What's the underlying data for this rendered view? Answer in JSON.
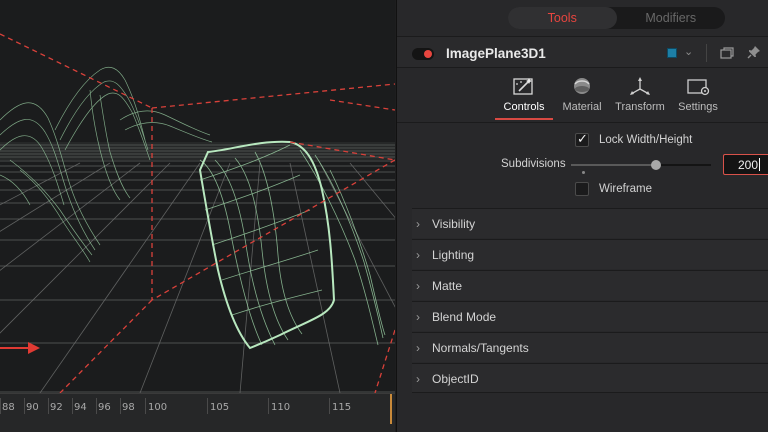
{
  "inspector": {
    "top_tabs": [
      {
        "label": "Tools",
        "active": true
      },
      {
        "label": "Modifiers",
        "active": false
      }
    ],
    "tool_name": "ImagePlane3D1",
    "tool_color": "#1d7fa6",
    "sub_tabs": [
      {
        "label": "Controls",
        "icon": "controls-icon",
        "active": true
      },
      {
        "label": "Material",
        "icon": "material-icon",
        "active": false
      },
      {
        "label": "Transform",
        "icon": "transform-icon",
        "active": false
      },
      {
        "label": "Settings",
        "icon": "settings-icon",
        "active": false
      }
    ],
    "lock_width_height": {
      "label": "Lock Width/Height",
      "checked": true
    },
    "subdivisions": {
      "label": "Subdivisions",
      "value": "200",
      "slider_fraction": 0.61
    },
    "wireframe": {
      "label": "Wireframe",
      "checked": false
    },
    "sections": [
      "Visibility",
      "Lighting",
      "Matte",
      "Blend Mode",
      "Normals/Tangents",
      "ObjectID"
    ]
  },
  "timeline": {
    "ticks": [
      "88",
      "90",
      "92",
      "94",
      "96",
      "98",
      "100",
      "105",
      "110",
      "115"
    ]
  },
  "colors": {
    "accent": "#e6453f",
    "wire": "#9fd6a8",
    "camera_guides": "#d9413a"
  }
}
